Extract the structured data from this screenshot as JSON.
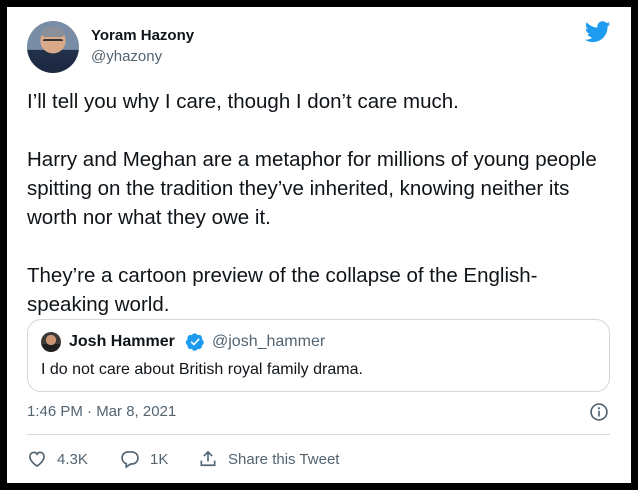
{
  "author": {
    "name": "Yoram Hazony",
    "handle": "@yhazony"
  },
  "tweet": {
    "paragraphs": [
      "I’ll tell you why I care, though I don’t care much.",
      "Harry and Meghan are a metaphor for millions of young people spitting on the tradition they’ve inherited, knowing neither its worth nor what they owe it.",
      "They’re a cartoon preview of the collapse of the English-speaking world."
    ],
    "timestamp": "1:46 PM · Mar 8, 2021"
  },
  "quoted": {
    "name": "Josh Hammer",
    "handle": "@josh_hammer",
    "text": "I do not care about British royal family drama."
  },
  "actions": {
    "likes": "4.3K",
    "replies": "1K",
    "share_label": "Share this Tweet"
  },
  "icons": {
    "brand": "twitter-bird-icon",
    "verified": "verified-badge-icon",
    "info": "info-icon",
    "like": "heart-icon",
    "reply": "reply-bubble-icon",
    "share": "share-icon"
  },
  "colors": {
    "twitter_blue": "#1d9bf0",
    "text_primary": "#0f1419",
    "text_secondary": "#536471",
    "border": "#cfd9de"
  }
}
